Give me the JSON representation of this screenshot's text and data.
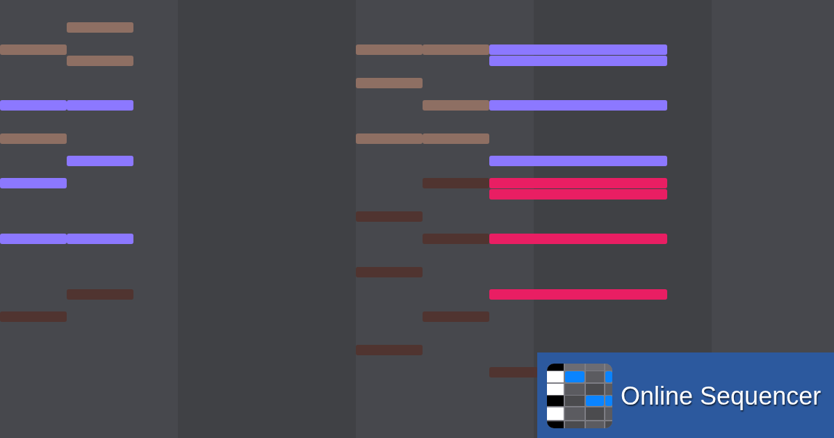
{
  "logo": {
    "text": "Online Sequencer"
  }
}
